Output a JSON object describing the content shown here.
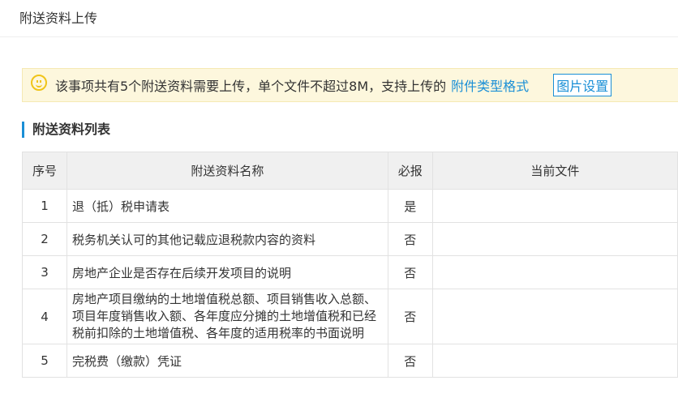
{
  "page_title": "附送资料上传",
  "notice": {
    "text": "该事项共有5个附送资料需要上传，单个文件不超过8M，支持上传的",
    "link": "附件类型格式",
    "button": "图片设置"
  },
  "section_title": "附送资料列表",
  "table": {
    "headers": [
      "序号",
      "附送资料名称",
      "必报",
      "当前文件"
    ],
    "rows": [
      {
        "no": "1",
        "name": "退（抵）税申请表",
        "required": "是",
        "file": ""
      },
      {
        "no": "2",
        "name": "税务机关认可的其他记载应退税款内容的资料",
        "required": "否",
        "file": ""
      },
      {
        "no": "3",
        "name": "房地产企业是否存在后续开发项目的说明",
        "required": "否",
        "file": ""
      },
      {
        "no": "4",
        "name": "房地产项目缴纳的土地增值税总额、项目销售收入总额、项目年度销售收入额、各年度应分摊的土地增值税和已经税前扣除的土地增值税、各年度的适用税率的书面说明",
        "required": "否",
        "file": ""
      },
      {
        "no": "5",
        "name": "完税费（缴款）凭证",
        "required": "否",
        "file": ""
      }
    ]
  }
}
